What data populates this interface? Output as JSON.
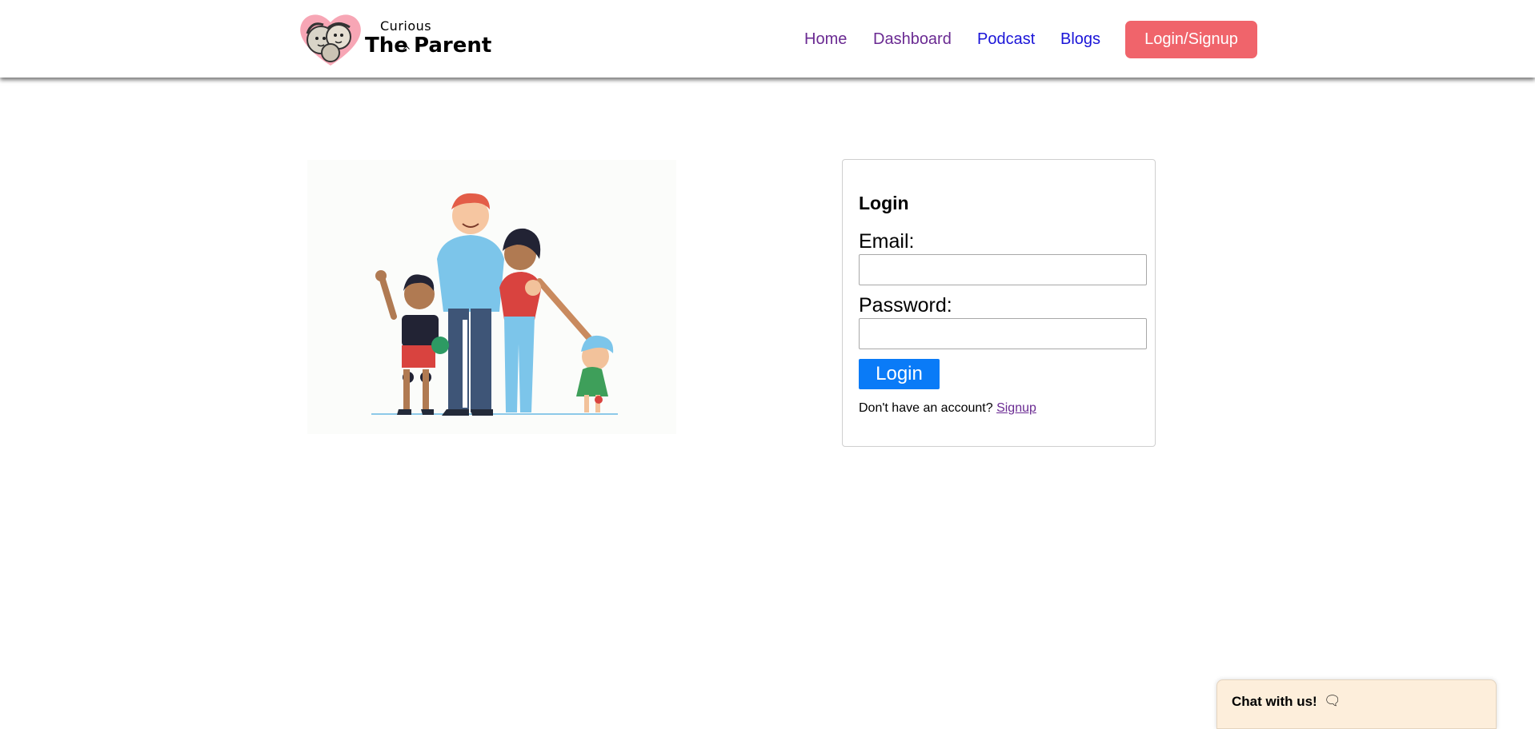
{
  "header": {
    "logo": {
      "top_word": "Curious",
      "word_the": "The",
      "word_parent": "Parent"
    },
    "nav": [
      {
        "label": "Home",
        "visited": true
      },
      {
        "label": "Dashboard",
        "visited": true
      },
      {
        "label": "Podcast",
        "visited": false
      },
      {
        "label": "Blogs",
        "visited": false
      }
    ],
    "cta_label": "Login/Signup"
  },
  "illustration": {
    "alt": "family-illustration"
  },
  "login": {
    "title": "Login",
    "email_label": "Email:",
    "email_value": "",
    "password_label": "Password:",
    "password_value": "",
    "button_label": "Login",
    "no_account_text": "Don't have an account?",
    "signup_label": "Signup"
  },
  "chat": {
    "label": "Chat with us!",
    "icon": "speech-bubbles-icon"
  },
  "colors": {
    "accent_cta": "#f0646b",
    "login_button": "#0a7bf7",
    "visited_link": "#6a2a92",
    "link": "#1a14d8",
    "chat_bg": "#fdeedb"
  }
}
